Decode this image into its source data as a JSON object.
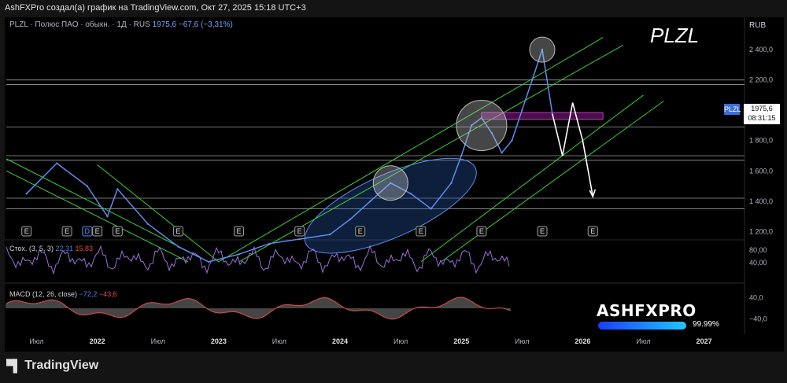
{
  "header": {
    "caption": "AshFXPro создал(а) график на TradingView.com, Окт 27, 2025 15:18 UTC+3"
  },
  "legend": {
    "symbol": "PLZL · Полюс ПАО · обыкн. · 1Д · RUS",
    "last": "1975,6",
    "change": "−67,6 (−3,31%)"
  },
  "watermark": "PLZL",
  "currency": "RUB",
  "price_marker": {
    "ticker": "PLZL",
    "price": "1975,6",
    "countdown": "08:31:15"
  },
  "stoch": {
    "label": "Стох. (3, 5, 3)",
    "k": "22,31",
    "d": "15,83"
  },
  "macd": {
    "label": "MACD (12, 26, close)",
    "hist": "−72,2",
    "signal": "−43,6"
  },
  "branding": {
    "logo_title": "ASHFXPRO",
    "logo_percent": "99.99%",
    "footer": "TradingView"
  },
  "event_markers": [
    "E",
    "E",
    "D",
    "E",
    "E",
    "E",
    "E",
    "E",
    "E",
    "E",
    "E",
    "E",
    "E"
  ],
  "colors": {
    "price": "#5b8def",
    "channel": "#3ccf3c",
    "stoch": "#9b6fd6",
    "macd_line": "#e84b4b",
    "projection": "#ffffff",
    "zone": "#c832c8"
  },
  "chart_data": [
    {
      "type": "line",
      "title": "",
      "x_ticks": [
        "Июл",
        "2022",
        "Июл",
        "2023",
        "Июл",
        "2024",
        "Июл",
        "2025",
        "Июл",
        "2026",
        "Июл",
        "2027"
      ],
      "y_ticks": [
        "2 400,0",
        "2 200,0",
        "2 000,0",
        "1 800,0",
        "1 600,0",
        "1 400,0",
        "1 200,0"
      ],
      "ylim": [
        1150,
        2520
      ],
      "series": [
        {
          "x": [
            "2021-06",
            "2021-09",
            "2021-12",
            "2022-02",
            "2022-03",
            "2022-06",
            "2022-09",
            "2022-12",
            "2023-03",
            "2023-06",
            "2023-09",
            "2023-12",
            "2024-02",
            "2024-04",
            "2024-06",
            "2024-08",
            "2024-10",
            "2024-12",
            "2025-01",
            "2025-02",
            "2025-03",
            "2025-04",
            "2025-05",
            "2025-06",
            "2025-07",
            "2025-08",
            "2025-09",
            "2025-10"
          ],
          "values": [
            1450,
            1650,
            1500,
            1300,
            1480,
            1250,
            1100,
            1000,
            1050,
            1120,
            1150,
            1180,
            1280,
            1400,
            1520,
            1450,
            1350,
            1520,
            1700,
            1900,
            1950,
            1850,
            1720,
            1800,
            2000,
            2200,
            2400,
            1975.6
          ]
        }
      ],
      "horizontal_levels": [
        2200,
        2170,
        1890,
        1700,
        1670,
        1420,
        1350
      ],
      "projection": {
        "x": [
          "2025-10",
          "2025-11",
          "2025-12",
          "2026-01",
          "2026-02"
        ],
        "values": [
          1975.6,
          1700,
          2050,
          1800,
          1430
        ]
      },
      "grid": false
    },
    {
      "type": "line",
      "title": "Стох. (3, 5, 3)",
      "y_ticks": [
        "80,00",
        "40,00"
      ],
      "ylim": [
        0,
        100
      ]
    },
    {
      "type": "bar",
      "title": "MACD (12, 26, close)",
      "y_ticks": [
        "40,0",
        "−40,0"
      ],
      "ylim": [
        -90,
        60
      ]
    }
  ]
}
